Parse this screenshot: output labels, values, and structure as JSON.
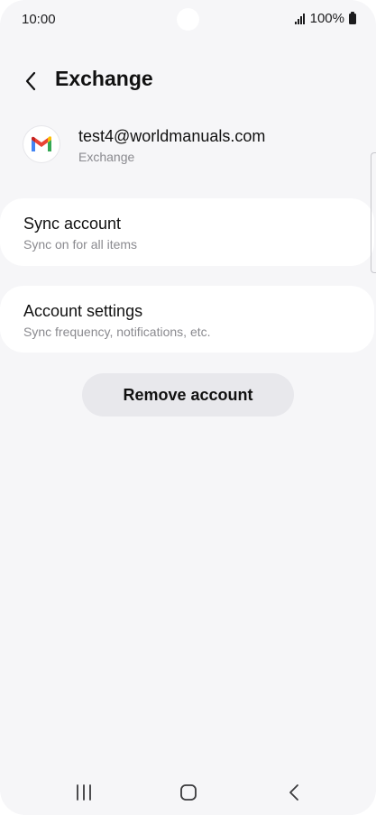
{
  "status_bar": {
    "time": "10:00",
    "battery": "100%",
    "icons": [
      "signal-icon",
      "battery-icon"
    ]
  },
  "header": {
    "title": "Exchange",
    "back_icon": "back-arrow-icon"
  },
  "account": {
    "email": "test4@worldmanuals.com",
    "type": "Exchange",
    "logo_icon": "gmail-icon"
  },
  "sync_account": {
    "title": "Sync account",
    "subtitle": "Sync on for all items"
  },
  "account_settings": {
    "title": "Account settings",
    "subtitle": "Sync frequency, notifications, etc."
  },
  "remove_button": {
    "label": "Remove account"
  },
  "nav_bar": {
    "icons": [
      "recents-icon",
      "home-icon",
      "back-icon"
    ]
  },
  "colors": {
    "background": "#f6f6f8",
    "card": "#ffffff",
    "button": "#e8e8ec",
    "text_primary": "#111111",
    "text_secondary": "#8a8a8f",
    "gmail_red": "#ea4335",
    "gmail_blue": "#4285f4",
    "gmail_green": "#34a853",
    "gmail_yellow": "#fbbc04"
  }
}
